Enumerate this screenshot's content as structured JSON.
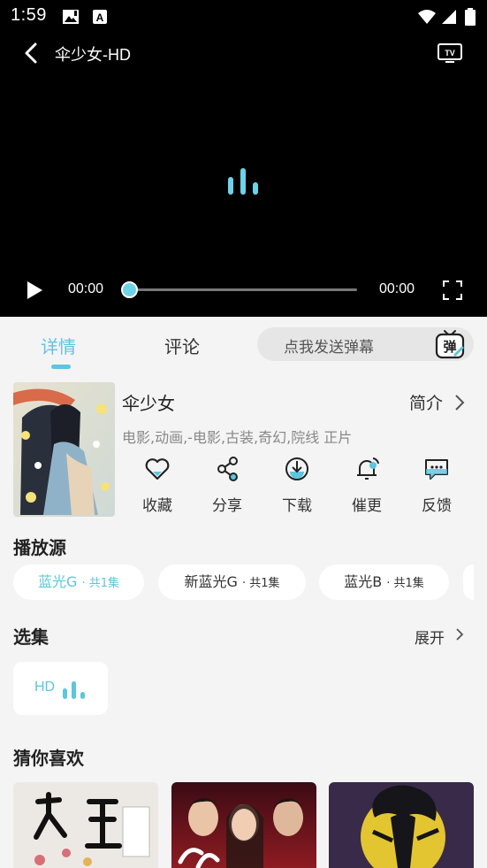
{
  "status_bar": {
    "time": "1:59"
  },
  "player": {
    "title": "伞少女-HD",
    "current_time": "00:00",
    "total_time": "00:00",
    "progress": 0
  },
  "tabs": [
    {
      "label": "详情",
      "active": true
    },
    {
      "label": "评论",
      "active": false
    }
  ],
  "danmu": {
    "placeholder": "点我发送弹幕",
    "icon_label": "弹"
  },
  "video": {
    "title": "伞少女",
    "intro_label": "简介",
    "tags": "电影,动画,-电影,古装,奇幻,院线 正片"
  },
  "actions": [
    {
      "label": "收藏",
      "icon": "heart-icon"
    },
    {
      "label": "分享",
      "icon": "share-icon"
    },
    {
      "label": "下载",
      "icon": "download-icon"
    },
    {
      "label": "催更",
      "icon": "bell-icon"
    },
    {
      "label": "反馈",
      "icon": "feedback-icon"
    }
  ],
  "sources": {
    "title": "播放源",
    "items": [
      {
        "name": "蓝光G",
        "count": "· 共1集",
        "active": true
      },
      {
        "name": "新蓝光G",
        "count": "· 共1集",
        "active": false
      },
      {
        "name": "蓝光B",
        "count": "· 共1集",
        "active": false
      }
    ]
  },
  "episodes": {
    "title": "选集",
    "expand_label": "展开",
    "items": [
      {
        "label": "HD",
        "playing": true
      }
    ]
  },
  "recommend": {
    "title": "猜你喜欢"
  },
  "colors": {
    "accent": "#5cc6de",
    "player_bg": "#000000",
    "page_bg": "#f4f4f4"
  }
}
